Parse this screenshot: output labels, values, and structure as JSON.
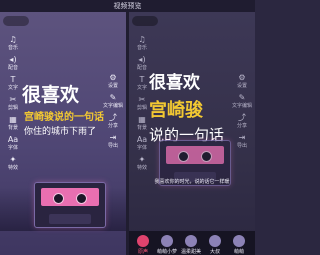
{
  "window": {
    "title": "视频预览"
  },
  "left": {
    "status": "",
    "tools": [
      {
        "icon": "music",
        "label": "音乐"
      },
      {
        "icon": "volume",
        "label": "配音"
      },
      {
        "icon": "text",
        "label": "文字"
      },
      {
        "icon": "cut",
        "label": "剪辑"
      },
      {
        "icon": "background",
        "label": "背景"
      },
      {
        "icon": "font",
        "label": "字体"
      },
      {
        "icon": "effect",
        "label": "特效"
      },
      {
        "icon": "settings",
        "label": "设置"
      },
      {
        "icon": "edit",
        "label": "文字编辑"
      },
      {
        "icon": "share",
        "label": "分享"
      },
      {
        "icon": "export",
        "label": "导出"
      }
    ],
    "line1": "很喜欢",
    "line2": "宫崎骏说的一句话",
    "line3": "你住的城市下雨了"
  },
  "right": {
    "status": "",
    "tools": [
      {
        "icon": "music",
        "label": "音乐"
      },
      {
        "icon": "volume",
        "label": "配音"
      },
      {
        "icon": "text",
        "label": "文字"
      },
      {
        "icon": "cut",
        "label": "剪辑"
      },
      {
        "icon": "background",
        "label": "背景"
      },
      {
        "icon": "font",
        "label": "字体"
      },
      {
        "icon": "effect",
        "label": "特效"
      },
      {
        "icon": "settings",
        "label": "设置"
      },
      {
        "icon": "edit",
        "label": "文字编辑"
      },
      {
        "icon": "share",
        "label": "分享"
      },
      {
        "icon": "export",
        "label": "导出"
      }
    ],
    "line1": "很喜欢",
    "line2": "宫崎骏",
    "line3": "说的一句话",
    "caption": "我喜欢你的时光，说的话它一样暖",
    "voices": [
      {
        "label": "原声",
        "active": true
      },
      {
        "label": "萌萌小萝",
        "active": false
      },
      {
        "label": "温柔甜美",
        "active": false
      },
      {
        "label": "大叔",
        "active": false
      },
      {
        "label": "萌萌",
        "active": false
      }
    ]
  },
  "colors": {
    "accent_yellow": "#f2c832",
    "active_voice": "#e0436e"
  }
}
